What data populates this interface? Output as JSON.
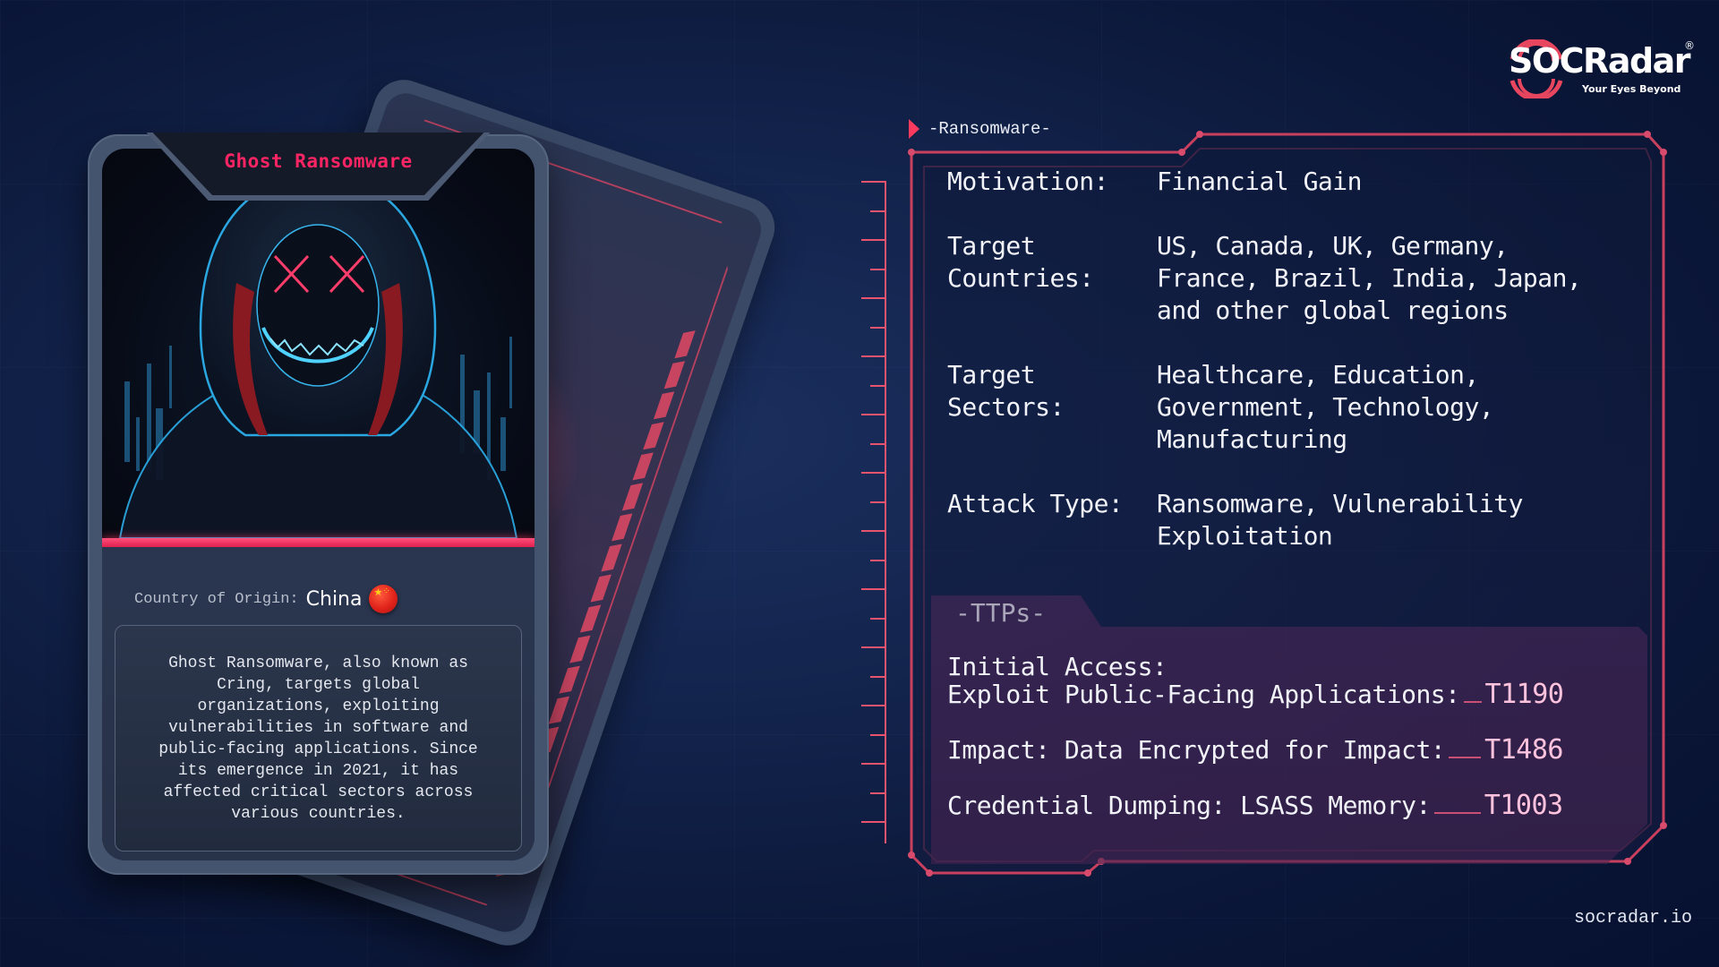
{
  "brand": {
    "logo_text": "SOCRadar",
    "registered_mark": "®",
    "tagline": "Your Eyes Beyond",
    "footer_url": "socradar.io",
    "accent_color": "#ff2463",
    "frame_color": "#e8536e"
  },
  "card": {
    "title": "Ghost Ransomware",
    "image_icon": "hooded-hacker-image",
    "origin_label": "Country of Origin:",
    "origin_value": "China",
    "origin_flag_icon": "china-flag-icon",
    "description": "Ghost Ransomware, also known as\nCring, targets global\norganizations, exploiting\nvulnerabilities in software and\npublic-facing applications. Since\nits emergence in 2021, it has\naffected critical sectors across\nvarious countries."
  },
  "panel": {
    "category_tag": "-Ransomware-",
    "rows": [
      {
        "label": "Motivation:",
        "value": "Financial Gain"
      },
      {
        "label": "Target\nCountries:",
        "value": "US, Canada, UK, Germany,\nFrance, Brazil, India, Japan,\nand other global regions"
      },
      {
        "label": "Target\nSectors:",
        "value": "Healthcare, Education,\nGovernment, Technology,\nManufacturing"
      },
      {
        "label": "Attack Type:",
        "value": "Ransomware, Vulnerability\nExploitation"
      }
    ],
    "ttps_title": "-TTPs-",
    "ttps": [
      {
        "name": "Initial Access:\nExploit Public-Facing Applications:",
        "id": "T1190"
      },
      {
        "name": "Impact: Data Encrypted for Impact:",
        "id": "T1486"
      },
      {
        "name": "Credential Dumping: LSASS Memory:",
        "id": "T1003"
      }
    ]
  }
}
